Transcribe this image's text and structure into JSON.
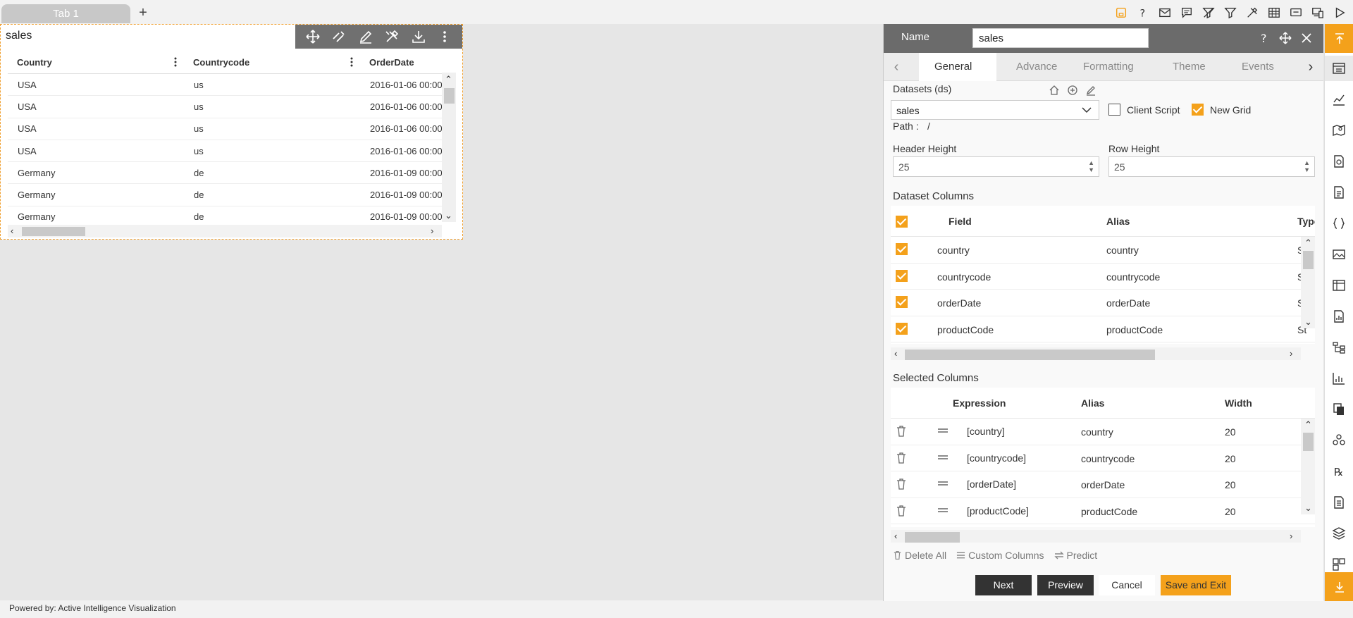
{
  "tabs": {
    "tab1": "Tab 1",
    "add": "+"
  },
  "top_icons": [
    "save-icon",
    "help-icon",
    "mail-icon",
    "comment-icon",
    "filter-clear-icon",
    "filter-icon",
    "tools-icon",
    "table-icon",
    "screen-icon",
    "devices-icon",
    "play-icon"
  ],
  "widget": {
    "title": "sales",
    "toolbar": [
      "move-icon",
      "link-icon",
      "edit-icon",
      "settings-icon",
      "download-icon",
      "more-icon"
    ],
    "columns": [
      "Country",
      "Countrycode",
      "OrderDate"
    ],
    "rows": [
      [
        "USA",
        "us",
        "2016-01-06 00:00"
      ],
      [
        "USA",
        "us",
        "2016-01-06 00:00"
      ],
      [
        "USA",
        "us",
        "2016-01-06 00:00"
      ],
      [
        "USA",
        "us",
        "2016-01-06 00:00"
      ],
      [
        "Germany",
        "de",
        "2016-01-09 00:00"
      ],
      [
        "Germany",
        "de",
        "2016-01-09 00:00"
      ],
      [
        "Germany",
        "de",
        "2016-01-09 00:00"
      ]
    ]
  },
  "footer": {
    "text": "Powered by: Active Intelligence Visualization"
  },
  "panel": {
    "name_label": "Name",
    "name_value": "sales",
    "tabs": [
      "General",
      "Advance",
      "Formatting",
      "Theme",
      "Events"
    ],
    "datasets_label": "Datasets (ds)",
    "dataset_value": "sales",
    "client_script": "Client Script",
    "client_script_checked": false,
    "new_grid": "New Grid",
    "new_grid_checked": true,
    "path_label": "Path :",
    "path_value": "/",
    "header_height_label": "Header Height",
    "header_height": "25",
    "row_height_label": "Row Height",
    "row_height": "25",
    "dataset_columns_title": "Dataset Columns",
    "dataset_columns_headers": [
      "Field",
      "Alias",
      "Type"
    ],
    "dataset_columns": [
      {
        "field": "country",
        "alias": "country",
        "type": "St"
      },
      {
        "field": "countrycode",
        "alias": "countrycode",
        "type": "St"
      },
      {
        "field": "orderDate",
        "alias": "orderDate",
        "type": "St"
      },
      {
        "field": "productCode",
        "alias": "productCode",
        "type": "St"
      }
    ],
    "selected_columns_title": "Selected Columns",
    "selected_columns_headers": [
      "Expression",
      "Alias",
      "Width"
    ],
    "selected_columns": [
      {
        "expr": "[country]",
        "alias": "country",
        "width": "20"
      },
      {
        "expr": "[countrycode]",
        "alias": "countrycode",
        "width": "20"
      },
      {
        "expr": "[orderDate]",
        "alias": "orderDate",
        "width": "20"
      },
      {
        "expr": "[productCode]",
        "alias": "productCode",
        "width": "20"
      }
    ],
    "delete_all": "Delete All",
    "custom_columns": "Custom Columns",
    "predict": "Predict",
    "buttons": {
      "next": "Next",
      "preview": "Preview",
      "cancel": "Cancel",
      "save_exit": "Save and Exit"
    }
  },
  "colors": {
    "accent": "#f4a11b",
    "header_bg": "#6b6b6b",
    "toolbar_bg": "#707070"
  }
}
